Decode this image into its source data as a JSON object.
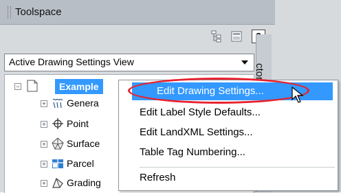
{
  "window": {
    "title": "Toolspace"
  },
  "toolbar": {
    "help_label": "?",
    "icons": [
      "tree-view-icon",
      "item-view-icon",
      "help-icon"
    ]
  },
  "view_selector": {
    "value": "Active Drawing Settings View"
  },
  "side_tab": {
    "label": "ctor"
  },
  "tree": {
    "root": {
      "label": "Example",
      "expander": "−"
    },
    "items": [
      {
        "label": "Genera",
        "icon": "general-icon"
      },
      {
        "label": "Point",
        "icon": "point-icon"
      },
      {
        "label": "Surface",
        "icon": "surface-icon"
      },
      {
        "label": "Parcel",
        "icon": "parcel-icon"
      },
      {
        "label": "Grading",
        "icon": "grading-icon"
      }
    ]
  },
  "context_menu": {
    "items": [
      {
        "label": "Edit Drawing Settings..."
      },
      {
        "label": "Edit Label Style Defaults..."
      },
      {
        "label": "Edit LandXML Settings..."
      },
      {
        "label": "Table Tag Numbering..."
      }
    ],
    "refresh": {
      "label": "Refresh"
    }
  },
  "colors": {
    "highlight": "#3399ff",
    "annotation_oval": "#e8212e"
  }
}
